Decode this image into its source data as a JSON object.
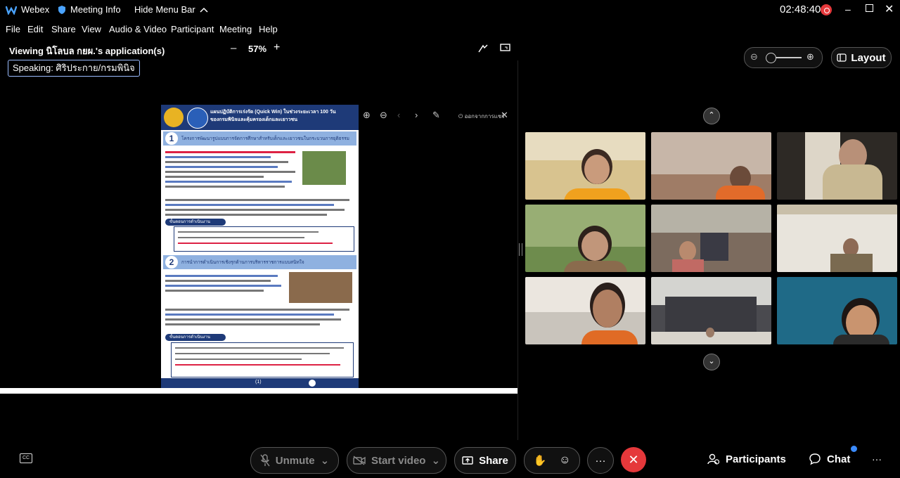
{
  "titlebar": {
    "app_name": "Webex",
    "meeting_info": "Meeting Info",
    "hide_menu": "Hide Menu Bar",
    "time": "02:48:40",
    "record_icon": "record-icon"
  },
  "menu": [
    "File",
    "Edit",
    "Share",
    "View",
    "Audio & Video",
    "Participant",
    "Meeting",
    "Help"
  ],
  "viewbar": {
    "viewing": "Viewing นิโลบล กยผ.'s application(s)",
    "zoom_minus": "–",
    "zoom": "57%",
    "zoom_plus": "+"
  },
  "speaking": "Speaking: ศิริประกาย/กรมพินิจ",
  "document": {
    "title_line1": "แผนปฏิบัติการเร่งรัด (Quick Win) ในช่วงระยะเวลา 100 วัน",
    "title_line2": "ของกรมพินิจและคุ้มครองเด็กและเยาวชน",
    "section1_title": "โครงการพัฒนารูปแบบการจัดการศึกษาสำหรับเด็กและเยาวชนในกระบวนการยุติธรรม",
    "section1_steps": "ขั้นตอนการดำเนินงาน",
    "section2_title": "การนำการดำเนินการเชิงรุกด้านการบริหารราชการแบบสนิทใจ",
    "section2_steps": "ขั้นตอนการดำเนินงาน",
    "page_no": "(1)",
    "exit_label": "ออกจากการแชร์"
  },
  "right_panel": {
    "layout_label": "Layout"
  },
  "bottom": {
    "unmute": "Unmute",
    "start_video": "Start video",
    "share": "Share",
    "more": "···",
    "participants": "Participants",
    "chat": "Chat",
    "overflow": "···"
  },
  "colors": {
    "end_call": "#e5383b",
    "badge": "#3b8bff"
  }
}
